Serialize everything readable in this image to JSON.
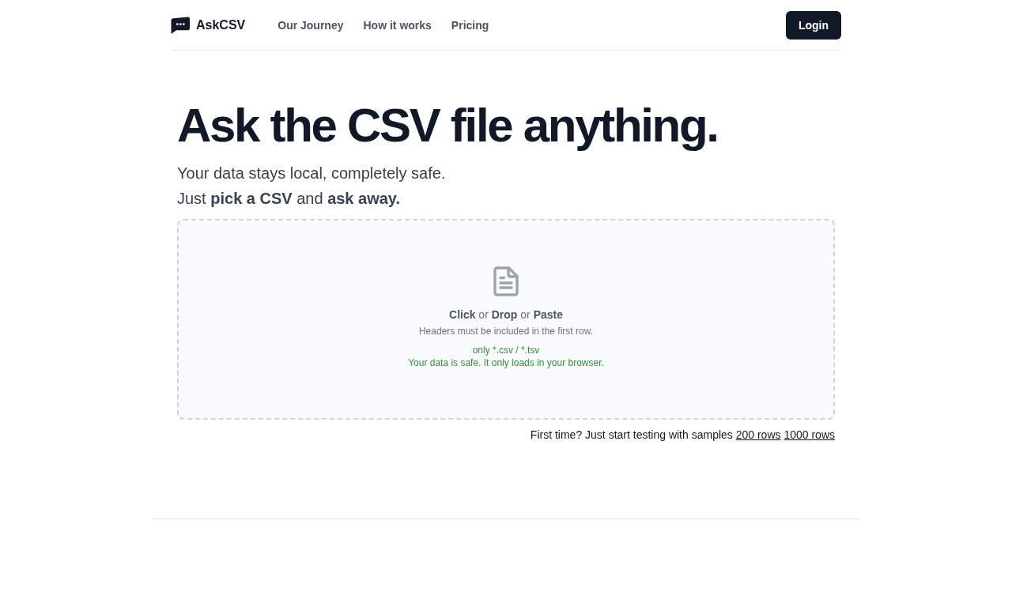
{
  "header": {
    "brand": "AskCSV",
    "nav": [
      "Our Journey",
      "How it works",
      "Pricing"
    ],
    "login": "Login"
  },
  "hero": {
    "title": "Ask the CSV file anything.",
    "subtitle": [
      "Your data stays local, completely safe.",
      "Just **pick a CSV** and **ask away.**"
    ]
  },
  "dropzone": {
    "prompt": "**Click** or **Drop** or **Paste**",
    "hint": "Headers must be included in the first row.",
    "notes": [
      "only *.csv / *.tsv",
      "Your data is safe. It only loads in your browser."
    ]
  },
  "samples": {
    "text": "First time? Just start testing with samples",
    "links": [
      "200 rows",
      "1000 rows"
    ]
  }
}
